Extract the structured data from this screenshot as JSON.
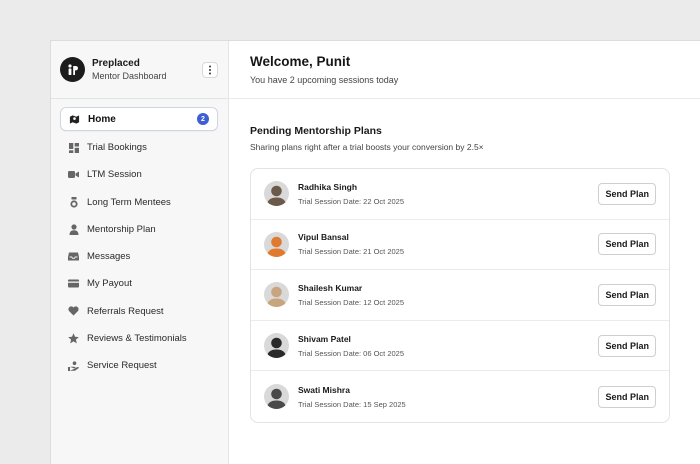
{
  "brand": {
    "name": "Preplaced",
    "subtitle": "Mentor Dashboard"
  },
  "sidebar": {
    "items": [
      {
        "label": "Home",
        "icon": "map-icon",
        "badge": "2",
        "active": true
      },
      {
        "label": "Trial Bookings",
        "icon": "grid-icon"
      },
      {
        "label": "LTM Session",
        "icon": "video-icon"
      },
      {
        "label": "Long Term Mentees",
        "icon": "medal-icon"
      },
      {
        "label": "Mentorship Plan",
        "icon": "person-icon"
      },
      {
        "label": "Messages",
        "icon": "inbox-icon"
      },
      {
        "label": "My Payout",
        "icon": "wallet-icon"
      },
      {
        "label": "Referrals Request",
        "icon": "heart-icon"
      },
      {
        "label": "Reviews & Testimonials",
        "icon": "star-icon"
      },
      {
        "label": "Service Request",
        "icon": "hand-icon"
      }
    ]
  },
  "header": {
    "title": "Welcome, Punit",
    "subtitle": "You have 2 upcoming sessions today"
  },
  "pending": {
    "title": "Pending Mentorship Plans",
    "subtitle": "Sharing plans right after a trial boosts your conversion by 2.5×",
    "button_label": "Send Plan",
    "rows": [
      {
        "name": "Radhika Singh",
        "date": "Trial Session Date: 22 Oct 2025",
        "avatar_color": "#6b5a4a"
      },
      {
        "name": "Vipul Bansal",
        "date": "Trial Session Date: 21 Oct 2025",
        "avatar_color": "#e07a2e"
      },
      {
        "name": "Shailesh Kumar",
        "date": "Trial Session Date: 12 Oct 2025",
        "avatar_color": "#c9a57f"
      },
      {
        "name": "Shivam Patel",
        "date": "Trial Session Date: 06 Oct 2025",
        "avatar_color": "#2a2a2a"
      },
      {
        "name": "Swati Mishra",
        "date": "Trial Session Date: 15 Sep 2025",
        "avatar_color": "#4a4a4a"
      }
    ]
  },
  "colors": {
    "accent": "#3e5fd3",
    "sidebar_bg": "#f7f7f7"
  }
}
